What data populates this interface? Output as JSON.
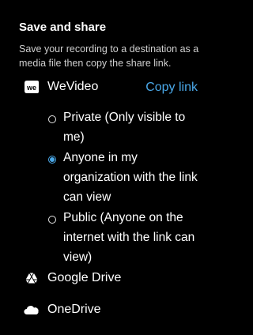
{
  "section": {
    "title": "Save and share",
    "description": "Save your recording to a destination as a media file then copy the share link."
  },
  "wevideo": {
    "label": "WeVideo",
    "logo_text": "we",
    "copy_link_label": "Copy link",
    "options": [
      {
        "label": "Private (Only visible to me)",
        "selected": false
      },
      {
        "label": "Anyone in my organization with the link can view",
        "selected": true
      },
      {
        "label": "Public (Anyone on the internet with the link can view)",
        "selected": false
      }
    ]
  },
  "destinations": {
    "google_drive": {
      "label": "Google Drive",
      "icon": "google-drive-icon"
    },
    "onedrive": {
      "label": "OneDrive",
      "icon": "onedrive-icon"
    }
  },
  "colors": {
    "background": "#000000",
    "accent": "#4aa8e8",
    "text": "#ffffff",
    "muted_text": "#cfcfcf"
  }
}
